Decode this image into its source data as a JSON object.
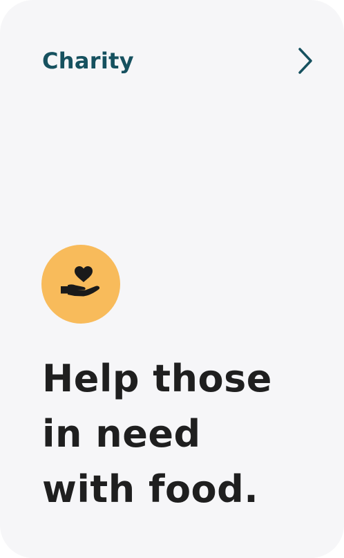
{
  "card": {
    "title": "Charity",
    "icon": "heart-in-hand-icon",
    "headline_lines": [
      "Help those",
      "in need",
      "with food."
    ]
  },
  "colors": {
    "card_background": "#f6f6f8",
    "title": "#16515f",
    "badge": "#f8bb5b",
    "headline": "#1f1f1f"
  }
}
